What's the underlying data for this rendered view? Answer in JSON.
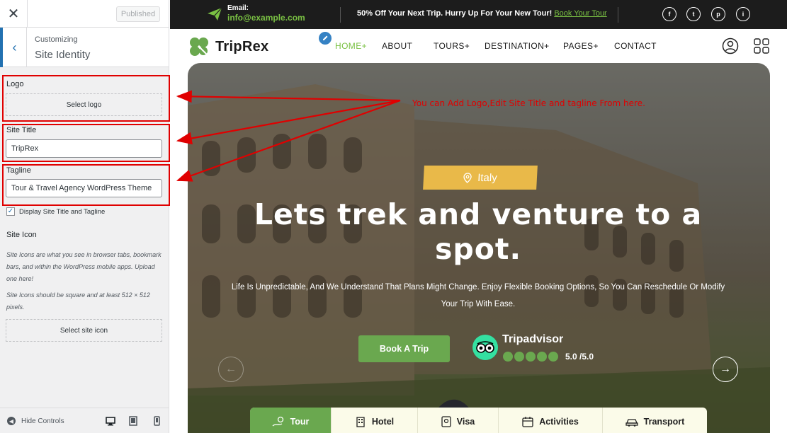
{
  "panel": {
    "close_icon": "close-icon",
    "publish_label": "Published",
    "back_icon": "chevron-left-icon",
    "customizing_label": "Customizing",
    "section_title": "Site Identity",
    "logo": {
      "label": "Logo",
      "button": "Select logo"
    },
    "site_title": {
      "label": "Site Title",
      "value": "TripRex"
    },
    "tagline": {
      "label": "Tagline",
      "value": "Tour & Travel Agency  WordPress Theme"
    },
    "display_checkbox": {
      "label": "Display Site Title and Tagline",
      "checked": true
    },
    "site_icon": {
      "title": "Site Icon",
      "desc1": "Site Icons are what you see in browser tabs, bookmark bars, and within the WordPress mobile apps. Upload one here!",
      "desc2": "Site Icons should be square and at least 512 × 512 pixels.",
      "button": "Select site icon"
    },
    "footer": {
      "hide_label": "Hide Controls",
      "devices": [
        "desktop-icon",
        "tablet-icon",
        "mobile-icon"
      ]
    }
  },
  "site": {
    "topbar": {
      "email_label": "Email:",
      "email_value": "info@example.com",
      "promo_text": "50% Off Your Next Trip. Hurry Up For Your New Tour!",
      "promo_link": "Book Your Tour",
      "social": [
        "f",
        "t",
        "p",
        "i"
      ]
    },
    "brand": "TripRex",
    "nav": [
      "HOME+",
      "ABOUT",
      "TOURS+",
      "DESTINATION+",
      "PAGES+",
      "CONTACT"
    ],
    "hero": {
      "tag": "Italy",
      "headline": "Lets trek and venture to a spot.",
      "subtext": "Life Is Unpredictable, And We Understand That Plans Might Change. Enjoy Flexible Booking Options, So You Can Reschedule Or Modify Your Trip With Ease.",
      "button": "Book A Trip",
      "tripadvisor": "Tripadvisor",
      "rating": "5.0 /5.0"
    },
    "tabs": [
      "Tour",
      "Hotel",
      "Visa",
      "Activities",
      "Transport"
    ]
  },
  "annotation": "You can Add Logo,Edit Site Title and tagline From here.",
  "colors": {
    "accent_green": "#6aa84f",
    "annotation_red": "#e00000",
    "wp_blue": "#2271b1",
    "tag_yellow": "#e9b949"
  }
}
